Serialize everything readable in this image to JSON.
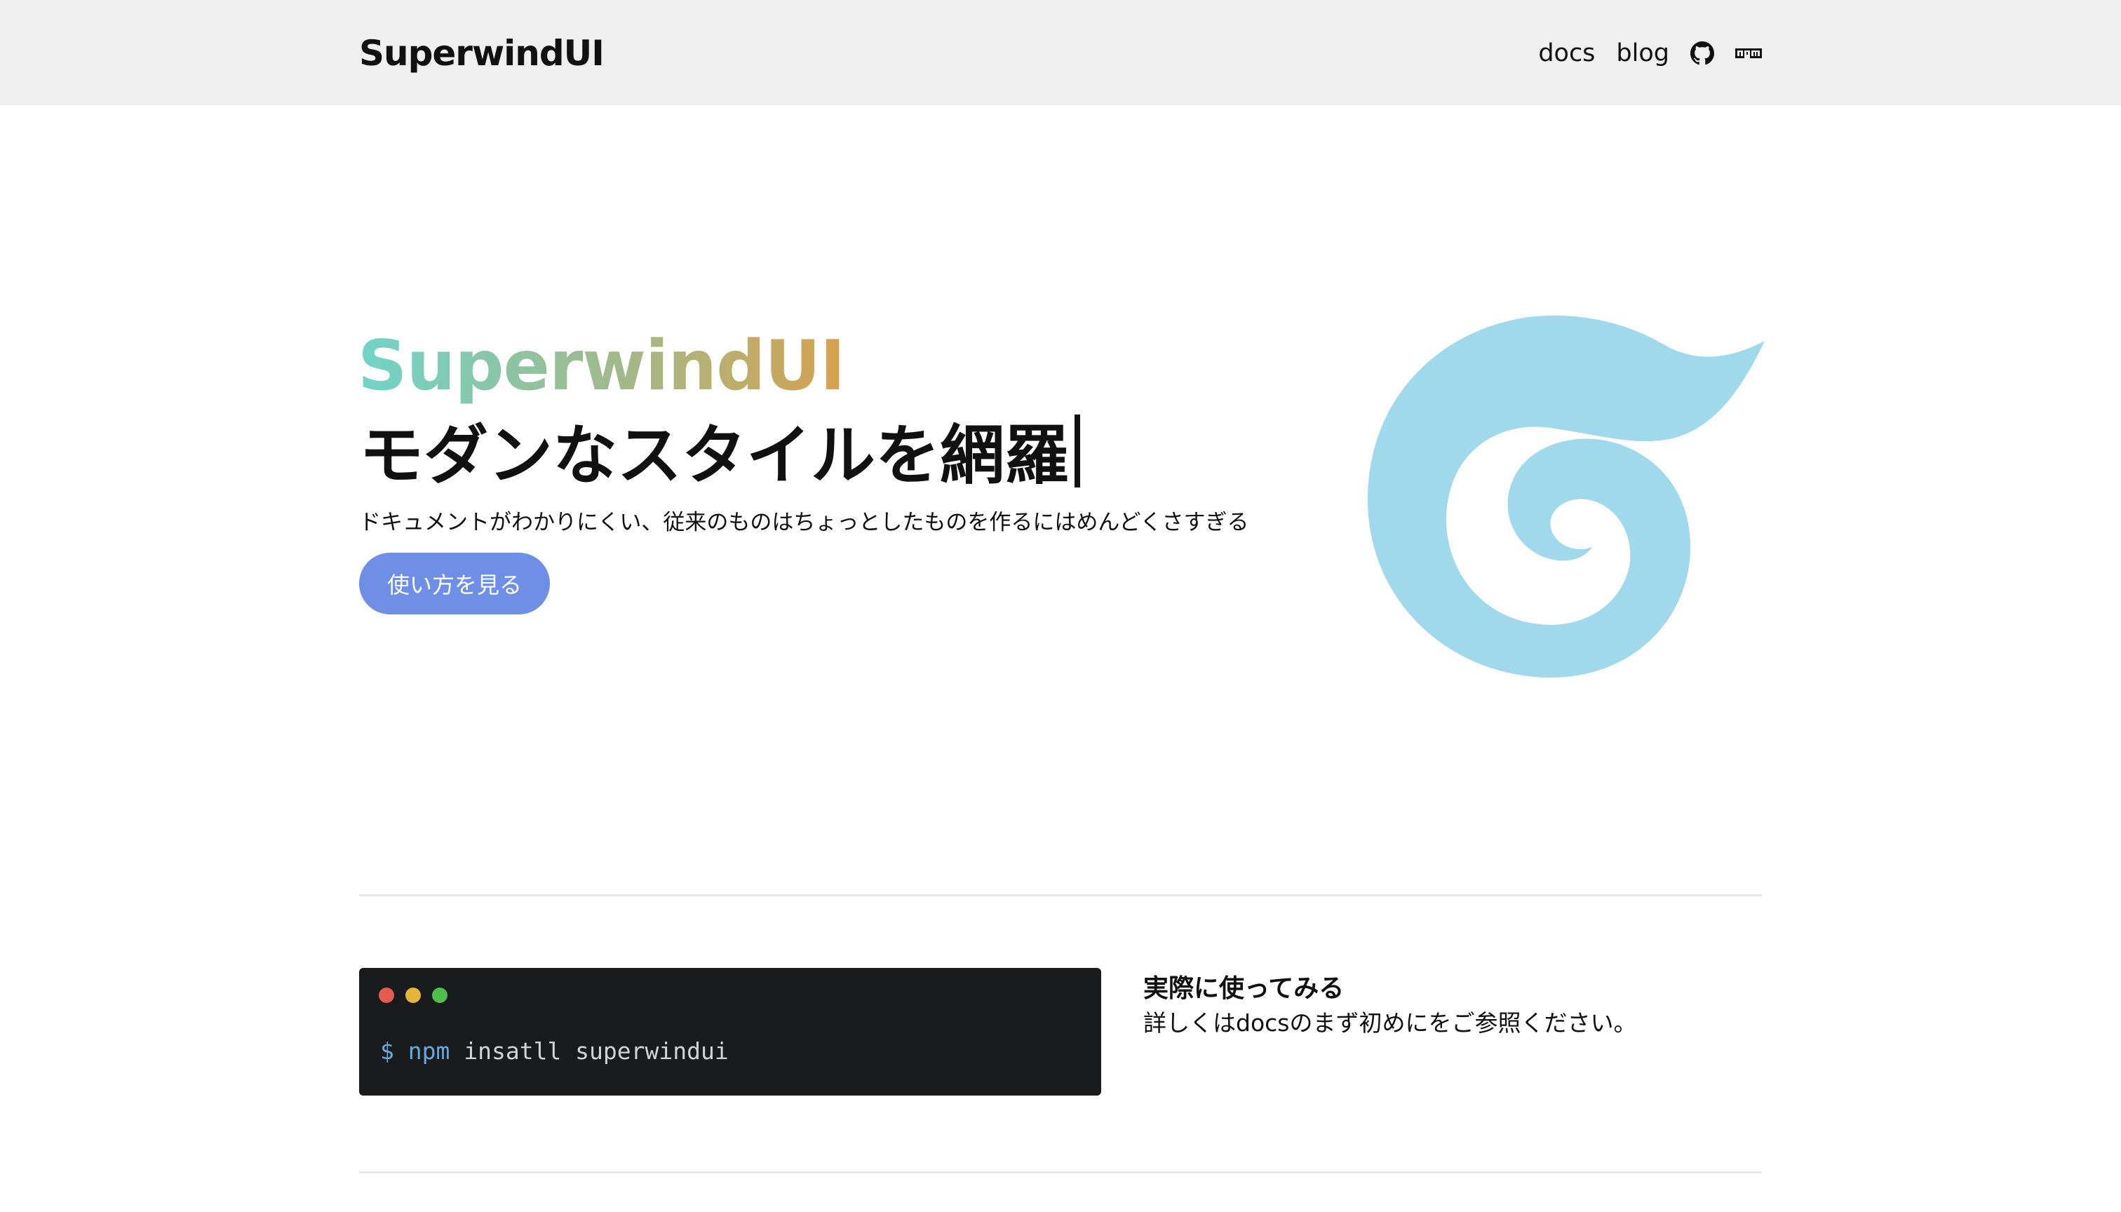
{
  "header": {
    "brand": "SuperwindUI",
    "nav": {
      "docs": "docs",
      "blog": "blog"
    },
    "icons": [
      "github-icon",
      "npm-icon"
    ]
  },
  "hero": {
    "title": "SuperwindUI",
    "subtitle": "モダンなスタイルを網羅",
    "description": "ドキュメントがわかりにくい、従来のものはちょっとしたものを作るにはめんどくさすぎる",
    "cta_label": "使い方を見る",
    "logo_icon": "swirl-logo-icon",
    "logo_color": "#a0d8ec",
    "cta_color": "#6f8ee6"
  },
  "install": {
    "prompt": "$",
    "command": "npm",
    "args": "insatll superwindui",
    "terminal_dots": [
      "#e45b4f",
      "#e6b43b",
      "#4fbe4a"
    ],
    "title": "実際に使ってみる",
    "description": "詳しくはdocsのまず初めにをご参照ください。"
  }
}
